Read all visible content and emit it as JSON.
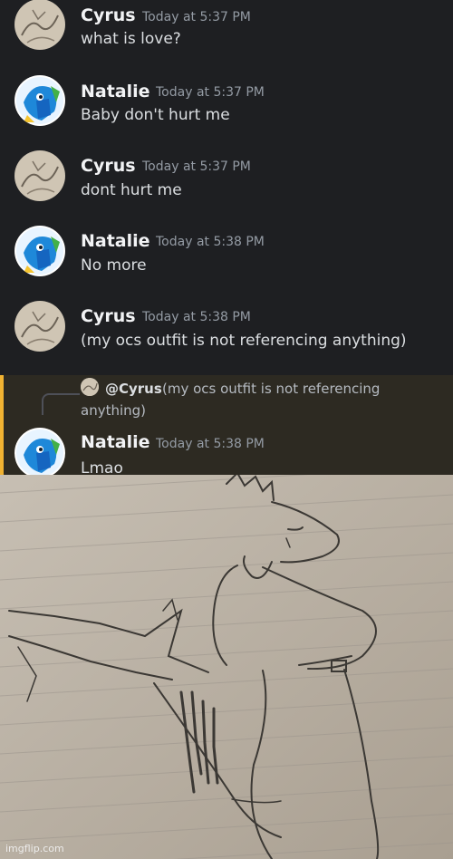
{
  "messages": [
    {
      "author": "Cyrus",
      "time": "Today at 5:37 PM",
      "text": "what is love?",
      "avatar": "cyrus-sketch"
    },
    {
      "author": "Natalie",
      "time": "Today at 5:37 PM",
      "text": "Baby don't hurt me",
      "avatar": "natalie-blue-character"
    },
    {
      "author": "Cyrus",
      "time": "Today at 5:37 PM",
      "text": "dont hurt me",
      "avatar": "cyrus-sketch"
    },
    {
      "author": "Natalie",
      "time": "Today at 5:38 PM",
      "text": "No more",
      "avatar": "natalie-blue-character"
    },
    {
      "author": "Cyrus",
      "time": "Today at 5:38 PM",
      "text": "(my ocs outfit is not referencing anything)",
      "avatar": "cyrus-sketch"
    }
  ],
  "reply": {
    "mention": "@Cyrus",
    "quoted_line1": "(my ocs outfit is not referencing anything)",
    "quoted_line2": "anything)",
    "quoted_first": "(my ocs outfit is not referencing",
    "author": "Natalie",
    "time": "Today at 5:38 PM",
    "text": "Lmao"
  },
  "image": {
    "subject": "pencil sketch of a character on lined paper"
  },
  "watermark": "imgflip.com",
  "colors": {
    "background": "#1e1f22",
    "mention_highlight": "#2d2a22",
    "mention_bar": "#f0b232",
    "username": "#f2f3f5",
    "timestamp": "#949ba4"
  }
}
